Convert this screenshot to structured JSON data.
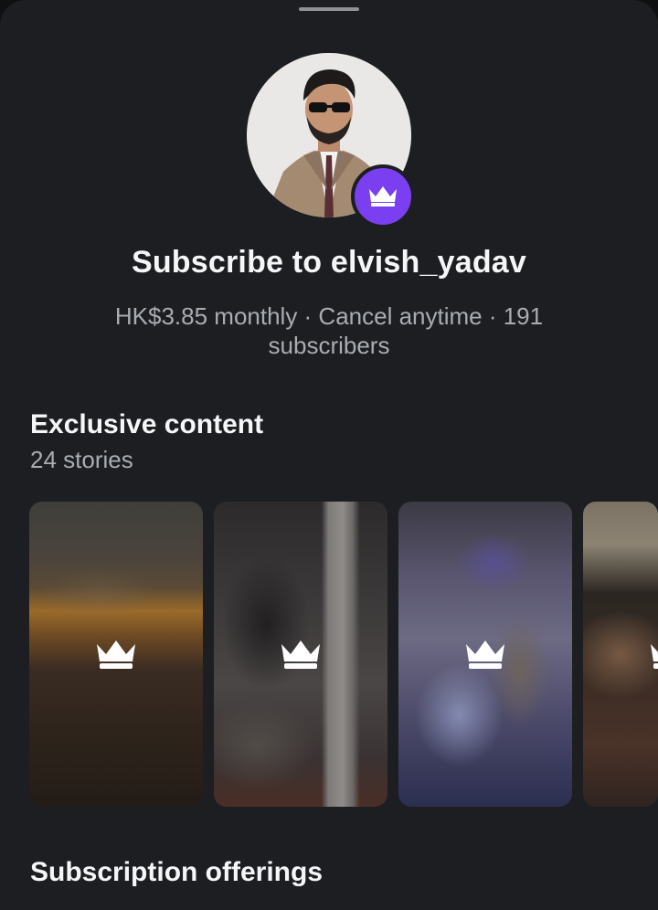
{
  "sheet": {
    "title": "Subscribe to elvish_yadav",
    "subtitle": "HK$3.85 monthly · Cancel anytime · 191 subscribers"
  },
  "avatar": {
    "username": "elvish_yadav",
    "badge_icon": "crown-icon",
    "badge_color": "#7a3ff0"
  },
  "exclusive": {
    "title": "Exclusive content",
    "count_label": "24 stories",
    "stories": [
      {
        "icon": "crown-icon"
      },
      {
        "icon": "crown-icon"
      },
      {
        "icon": "crown-icon"
      },
      {
        "icon": "crown-icon"
      }
    ]
  },
  "offerings": {
    "title": "Subscription offerings"
  },
  "colors": {
    "background": "#1c1e21",
    "text_primary": "#f5f6f7",
    "text_secondary": "#a9adb3",
    "accent": "#7a3ff0"
  }
}
